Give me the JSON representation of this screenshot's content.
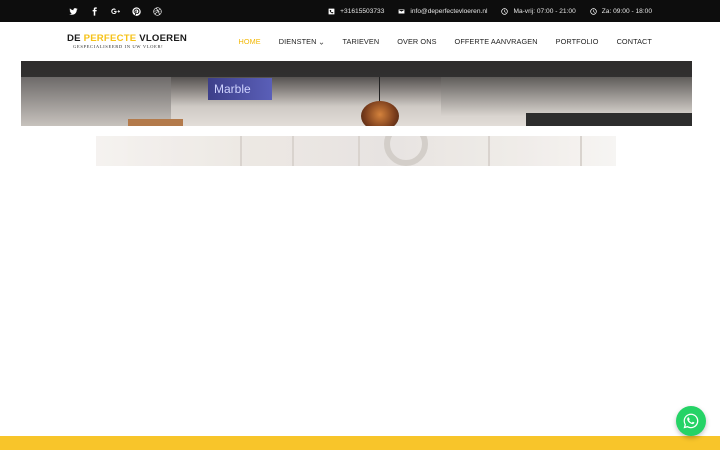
{
  "topbar": {
    "social_icons": [
      "twitter-icon",
      "facebook-icon",
      "google-plus-icon",
      "pinterest-icon",
      "dribbble-icon"
    ],
    "social_glyphs": [
      "",
      "f",
      "G+",
      "",
      ""
    ],
    "phone": "+31615503733",
    "email": "info@deperfectevloeren.nl",
    "hours_weekdays": "Ma-vrij: 07:00 - 21:00",
    "hours_saturday": "Za: 09:00 - 18:00"
  },
  "logo": {
    "word1": "DE",
    "word2": "PERFECTE",
    "word3": "VLOEREN",
    "tagline": "GESPECIALISEERD IN UW VLOER!"
  },
  "nav": {
    "items": [
      {
        "label": "HOME",
        "active": true
      },
      {
        "label": "DIENSTEN",
        "has_dropdown": true
      },
      {
        "label": "TARIEVEN"
      },
      {
        "label": "OVER ONS"
      },
      {
        "label": "OFFERTE AANVRAGEN"
      },
      {
        "label": "PORTFOLIO"
      },
      {
        "label": "CONTACT"
      }
    ]
  },
  "hero": {
    "sign_text": "Marble"
  },
  "colors": {
    "accent": "#f8c52a",
    "active_nav": "#f2b705",
    "topbar_bg": "#0d0d0d",
    "whatsapp": "#25d366"
  },
  "widgets": {
    "chat_icon": "whatsapp-icon"
  }
}
